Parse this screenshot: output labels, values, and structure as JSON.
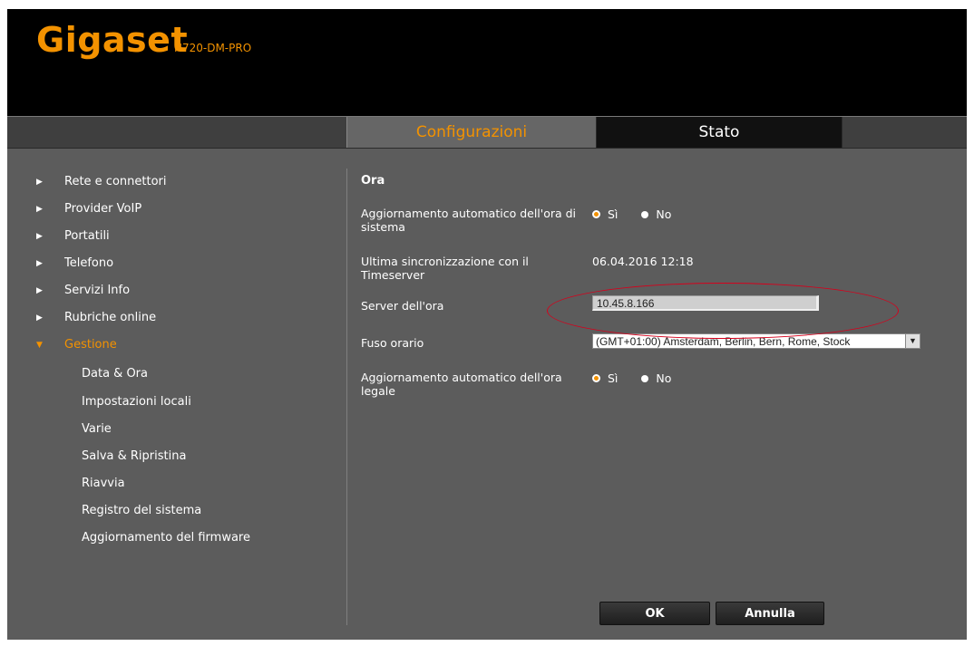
{
  "header": {
    "brand": "Gigaset",
    "model": "N720-DM-PRO"
  },
  "tabs": [
    {
      "label": "Configurazioni",
      "active": true
    },
    {
      "label": "Stato",
      "active": false
    }
  ],
  "sidebar": {
    "items": [
      {
        "label": "Rete e connettori",
        "icon": "triangle-right-icon"
      },
      {
        "label": "Provider VoIP",
        "icon": "triangle-right-icon"
      },
      {
        "label": "Portatili",
        "icon": "triangle-right-icon"
      },
      {
        "label": "Telefono",
        "icon": "triangle-right-icon"
      },
      {
        "label": "Servizi Info",
        "icon": "triangle-right-icon"
      },
      {
        "label": "Rubriche online",
        "icon": "triangle-right-icon"
      },
      {
        "label": "Gestione",
        "icon": "triangle-down-icon",
        "active": true
      }
    ],
    "subitems": [
      {
        "label": "Data & Ora",
        "active": true
      },
      {
        "label": "Impostazioni locali"
      },
      {
        "label": "Varie"
      },
      {
        "label": "Salva & Ripristina"
      },
      {
        "label": "Riavvia"
      },
      {
        "label": "Registro del sistema"
      },
      {
        "label": "Aggiornamento del firmware"
      }
    ]
  },
  "content": {
    "section_title": "Ora",
    "auto_update": {
      "label": "Aggiornamento automatico dell'ora di sistema",
      "options": [
        "Sì",
        "No"
      ],
      "selected": "Sì"
    },
    "last_sync": {
      "label": "Ultima sincronizzazione con il Timeserver",
      "value": "06.04.2016 12:18"
    },
    "time_server": {
      "label": "Server dell'ora",
      "value": "10.45.8.166"
    },
    "timezone": {
      "label": "Fuso orario",
      "value": "(GMT+01:00) Amsterdam, Berlin, Bern, Rome, Stock"
    },
    "dst": {
      "label": "Aggiornamento automatico dell'ora legale",
      "options": [
        "Sì",
        "No"
      ],
      "selected": "Sì"
    }
  },
  "buttons": {
    "ok": "OK",
    "cancel": "Annulla"
  },
  "colors": {
    "accent": "#f39200",
    "highlight_ellipse": "#d6001c",
    "background": "#5c5c5c"
  }
}
